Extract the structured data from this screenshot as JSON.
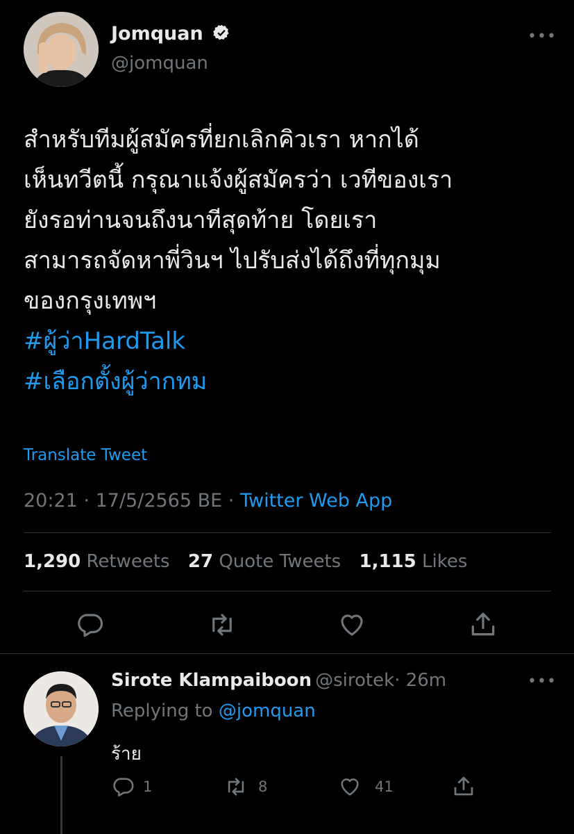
{
  "tweet": {
    "author": {
      "name": "Jomquan",
      "handle": "@jomquan",
      "verified": true,
      "avatar_icon": "user-avatar"
    },
    "more_label": "•••",
    "body_lines": [
      "สำหรับทีมผู้สมัครที่ยกเลิกคิวเรา หากได้",
      "เห็นทวีตนี้ กรุณาแจ้งผู้สมัครว่า เวทีของเรา",
      "ยังรอท่านจนถึงนาทีสุดท้าย โดยเรา",
      "สามารถจัดหาพี่วินฯ ไปรับส่งได้ถึงที่ทุกมุม",
      "ของกรุงเทพฯ"
    ],
    "hashtags": [
      "#ผู้ว่าHardTalk",
      "#เลือกตั้งผู้ว่ากทม"
    ],
    "translate_label": "Translate Tweet",
    "time": "20:21",
    "date": "17/5/2565 BE",
    "separator": "·",
    "source": "Twitter Web App",
    "stats": {
      "retweets_count": "1,290",
      "retweets_label": "Retweets",
      "quotes_count": "27",
      "quotes_label": "Quote Tweets",
      "likes_count": "1,115",
      "likes_label": "Likes"
    }
  },
  "reply": {
    "author": {
      "name": "Sirote Klampaiboon",
      "handle": "@sirotek",
      "time": "· 26m"
    },
    "replying_prefix": "Replying to",
    "replying_mention": "@jomquan",
    "text": "ร้าย",
    "more_label": "•••",
    "counts": {
      "replies": "1",
      "retweets": "8",
      "likes": "41"
    }
  },
  "colors": {
    "background": "#000000",
    "accent": "#1d9bf0",
    "secondary_text": "#71767b",
    "primary_text": "#e7e9ea",
    "divider": "#2f3336"
  }
}
